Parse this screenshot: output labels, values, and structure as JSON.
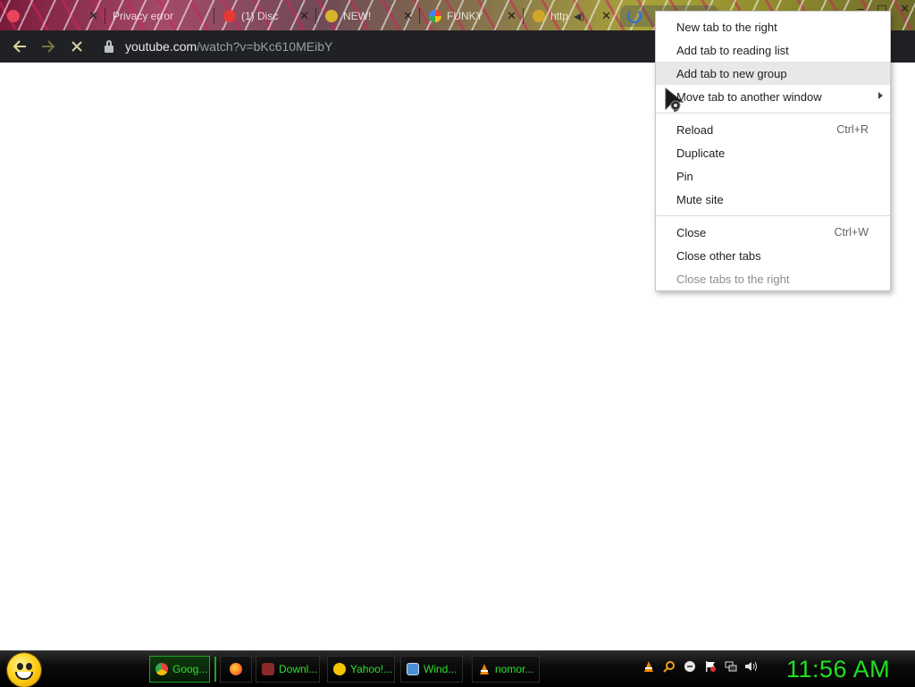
{
  "tabs": [
    {
      "title": "",
      "favicon": "pink-favicon-icon",
      "color": "#e8455a"
    },
    {
      "title": "Privacy error",
      "favicon": "red-dot-icon",
      "color": "#e0223a"
    },
    {
      "title": "(1) Disc",
      "favicon": "discord-icon",
      "color": "#e53935"
    },
    {
      "title": "NEW!",
      "favicon": "yellow-favicon-icon",
      "color": "#d6b52a"
    },
    {
      "title": "FUNKY",
      "favicon": "google-icon",
      "color": "#4285f4"
    },
    {
      "title": "http",
      "favicon": "yellow-favicon-icon",
      "color": "#cfa52c"
    },
    {
      "title": "",
      "favicon": "loading-spinner-icon",
      "color": "#2b6fd6"
    }
  ],
  "omnibox": {
    "host": "youtube.com",
    "path": "/watch?v=bKc610MEibY"
  },
  "context_menu": {
    "items": [
      {
        "label": "New tab to the right",
        "shortcut": "",
        "state": "normal",
        "submenu": false
      },
      {
        "label": "Add tab to reading list",
        "shortcut": "",
        "state": "normal",
        "submenu": false
      },
      {
        "label": "Add tab to new group",
        "shortcut": "",
        "state": "highlighted",
        "submenu": false
      },
      {
        "label": "Move tab to another window",
        "shortcut": "",
        "state": "normal",
        "submenu": true
      },
      {
        "separator": true
      },
      {
        "label": "Reload",
        "shortcut": "Ctrl+R",
        "state": "normal",
        "submenu": false
      },
      {
        "label": "Duplicate",
        "shortcut": "",
        "state": "normal",
        "submenu": false
      },
      {
        "label": "Pin",
        "shortcut": "",
        "state": "normal",
        "submenu": false
      },
      {
        "label": "Mute site",
        "shortcut": "",
        "state": "normal",
        "submenu": false
      },
      {
        "separator": true
      },
      {
        "label": "Close",
        "shortcut": "Ctrl+W",
        "state": "normal",
        "submenu": false
      },
      {
        "label": "Close other tabs",
        "shortcut": "",
        "state": "normal",
        "submenu": false
      },
      {
        "label": "Close tabs to the right",
        "shortcut": "",
        "state": "disabled",
        "submenu": false
      }
    ]
  },
  "taskbar": {
    "tasks": [
      {
        "label": "Goog...",
        "icon": "chrome-icon",
        "color": "#e8453c",
        "active": true
      },
      {
        "label": "",
        "icon": "firefox-icon",
        "color": "#ff7a1a",
        "active": false
      },
      {
        "label": "Downl...",
        "icon": "download-icon",
        "color": "#8a2a2a",
        "active": false
      },
      {
        "label": "Yahoo!...",
        "icon": "yahoo-smiley-icon",
        "color": "#f5c400",
        "active": false
      },
      {
        "label": "Wind...",
        "icon": "window-icon",
        "color": "#4a8fd6",
        "active": false
      },
      {
        "label": "nomor...",
        "icon": "vlc-icon",
        "color": "#f08a00",
        "active": false
      }
    ],
    "tray_icons": [
      "vlc-tray-icon",
      "search-tray-icon",
      "chat-tray-icon",
      "flag-tray-icon",
      "network-tray-icon",
      "volume-tray-icon"
    ],
    "clock": "11:56 AM"
  },
  "colors": {
    "toolbar_bg": "#202124",
    "clock_green": "#20e020",
    "menu_highlight": "#e8e8e8"
  }
}
